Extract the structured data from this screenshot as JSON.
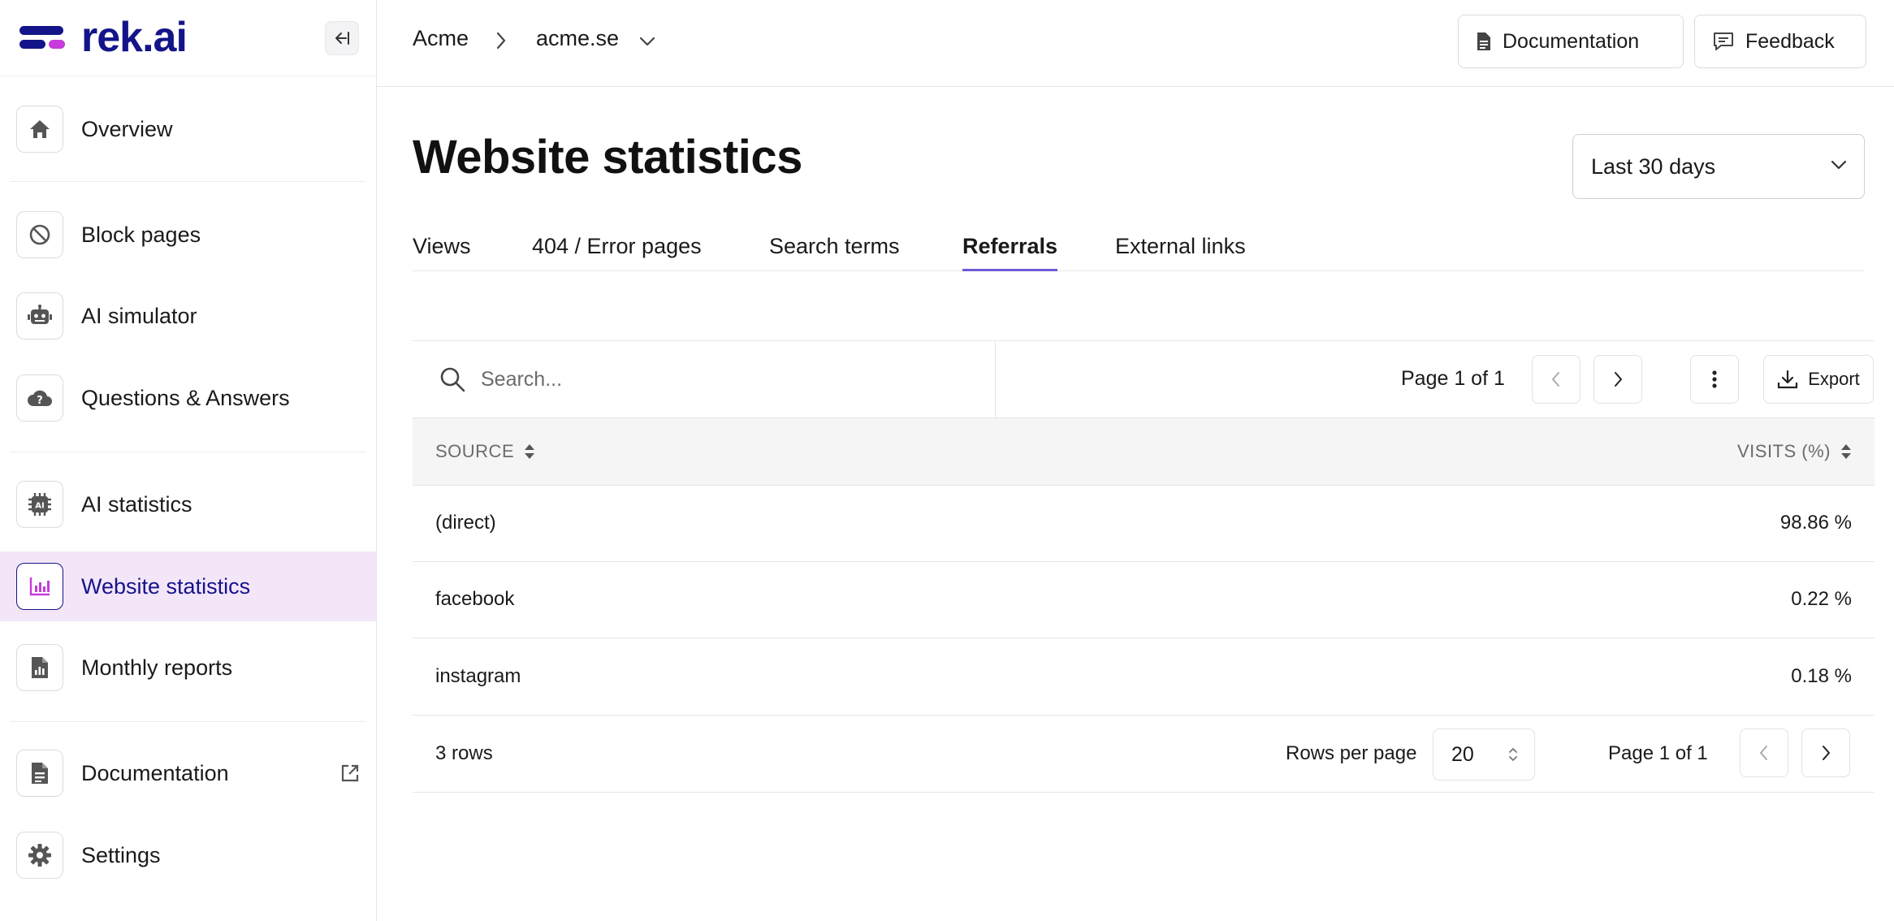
{
  "app": {
    "logo_text": "rek.ai"
  },
  "sidebar": {
    "items": [
      {
        "label": "Overview",
        "icon": "home-icon"
      },
      {
        "label": "Block pages",
        "icon": "block-icon"
      },
      {
        "label": "AI simulator",
        "icon": "robot-icon"
      },
      {
        "label": "Questions & Answers",
        "icon": "cloud-question-icon"
      },
      {
        "label": "AI statistics",
        "icon": "ai-chip-icon"
      },
      {
        "label": "Website statistics",
        "icon": "bar-chart-icon",
        "active": true
      },
      {
        "label": "Monthly reports",
        "icon": "report-file-icon"
      },
      {
        "label": "Documentation",
        "icon": "document-icon",
        "external": true
      },
      {
        "label": "Settings",
        "icon": "gear-icon"
      }
    ]
  },
  "header": {
    "breadcrumb_org": "Acme",
    "breadcrumb_site": "acme.se",
    "documentation_label": "Documentation",
    "feedback_label": "Feedback"
  },
  "main": {
    "title": "Website statistics",
    "date_range": "Last 30 days",
    "tabs": [
      {
        "label": "Views"
      },
      {
        "label": "404 / Error pages"
      },
      {
        "label": "Search terms"
      },
      {
        "label": "Referrals",
        "active": true
      },
      {
        "label": "External links"
      }
    ]
  },
  "table": {
    "search_placeholder": "Search...",
    "page_info": "Page 1 of 1",
    "export_label": "Export",
    "columns": {
      "source": "SOURCE",
      "visits": "VISITS (%)"
    },
    "rows": [
      {
        "source": "(direct)",
        "visits": "98.86 %"
      },
      {
        "source": "facebook",
        "visits": "0.22 %"
      },
      {
        "source": "instagram",
        "visits": "0.18 %"
      }
    ],
    "row_count": "3 rows",
    "rows_per_page_label": "Rows per page",
    "rows_per_page_value": "20",
    "footer_page_info": "Page 1 of 1"
  },
  "colors": {
    "brand_navy": "#14148a",
    "brand_magenta": "#c63bd9",
    "active_bg": "#f4e6f9",
    "tab_underline": "#6b5bd6"
  }
}
